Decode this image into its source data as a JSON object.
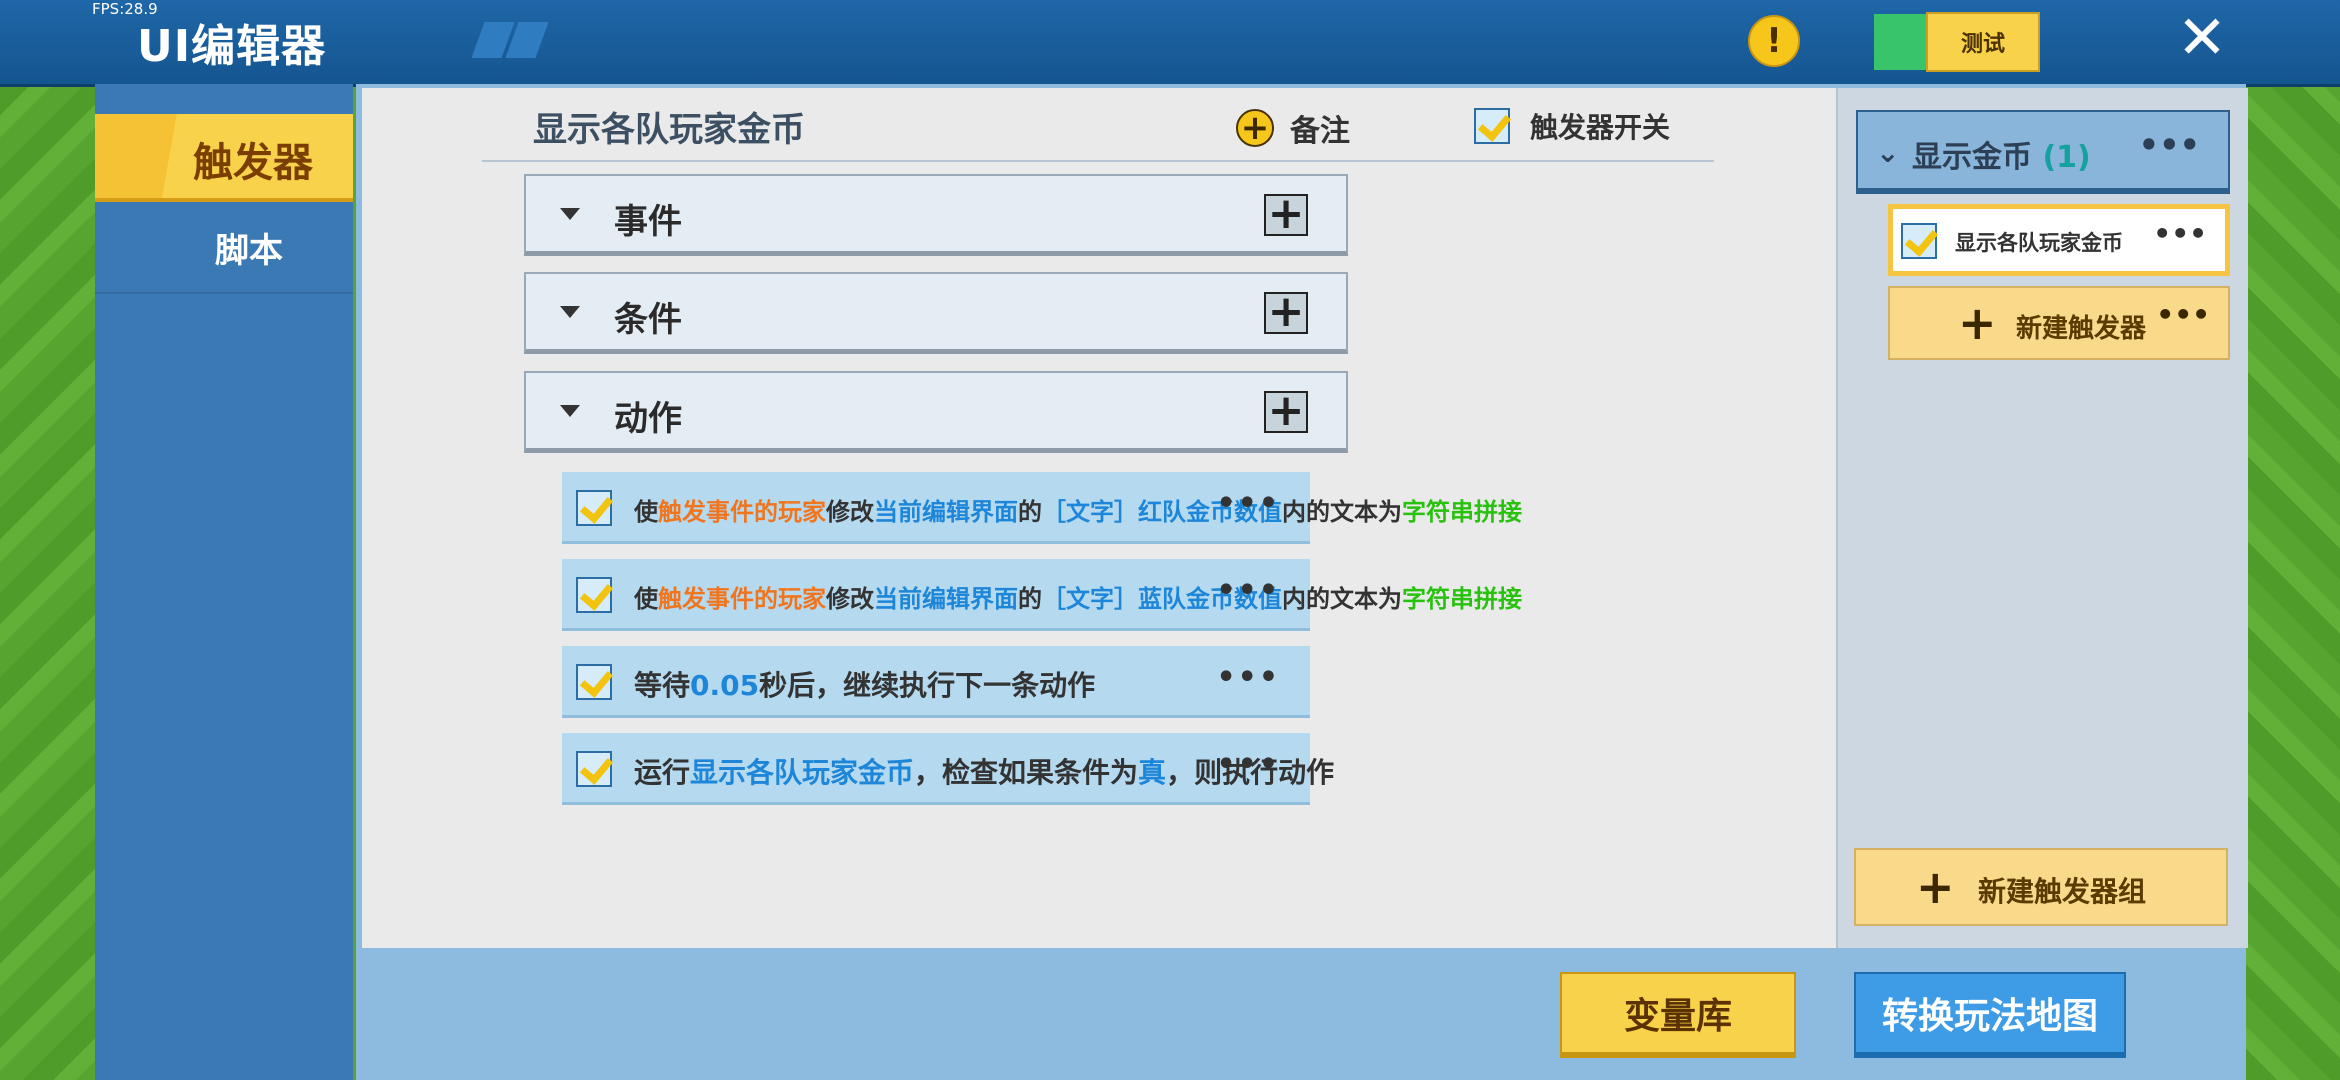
{
  "header": {
    "fps": "FPS:28.9",
    "title": "UI编辑器",
    "test_label": "测试",
    "warning_icon": "exclamation-icon",
    "close_icon": "close-icon"
  },
  "sidebar": {
    "items": [
      {
        "label": "触发器",
        "active": true
      },
      {
        "label": "脚本",
        "active": false
      }
    ]
  },
  "editor": {
    "trigger_title": "显示各队玩家金币",
    "note_label": "备注",
    "switch_label": "触发器开关",
    "sections": [
      {
        "label": "事件"
      },
      {
        "label": "条件"
      },
      {
        "label": "动作"
      }
    ],
    "actions": [
      {
        "parts": [
          "使",
          "触发事件的玩家",
          "修改",
          "当前编辑界面",
          "的",
          "［文字］红队金币数值",
          "内的文本为",
          "字符串拼接"
        ]
      },
      {
        "parts": [
          "使",
          "触发事件的玩家",
          "修改",
          "当前编辑界面",
          "的",
          "［文字］蓝队金币数值",
          "内的文本为",
          "字符串拼接"
        ]
      },
      {
        "parts": [
          "等待",
          "0.05",
          "秒后，继续执行下一条动作"
        ]
      },
      {
        "parts": [
          "运行",
          "显示各队玩家金币",
          "，检查如果条件为",
          "真",
          "，则执行动作"
        ]
      }
    ]
  },
  "right_panel": {
    "group_name": "显示金币",
    "group_count": "(1)",
    "trigger_item": "显示各队玩家金币",
    "new_trigger": "新建触发器",
    "new_group": "新建触发器组"
  },
  "footer": {
    "variables_button": "变量库",
    "convert_button": "转换玩法地图"
  },
  "colors": {
    "orange_highlight": "#f0751f",
    "blue_highlight": "#1d86d8",
    "green_highlight": "#28c20e",
    "accent_yellow": "#f9d24b"
  }
}
